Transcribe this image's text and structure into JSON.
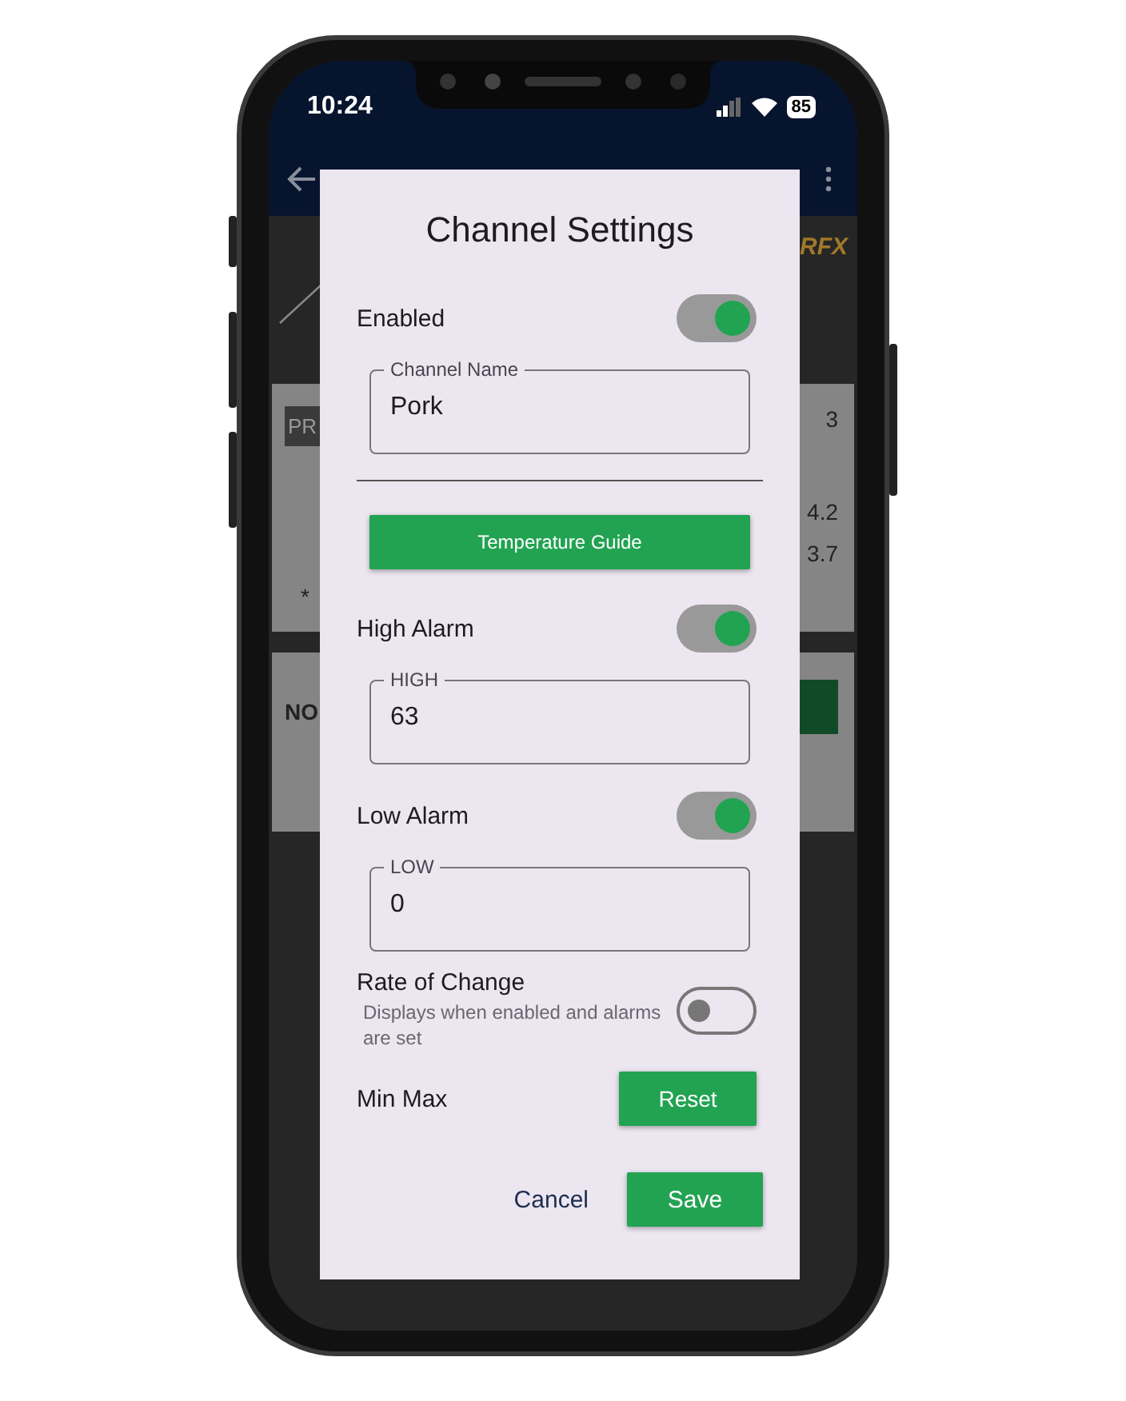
{
  "status_bar": {
    "time": "10:24",
    "battery": "85"
  },
  "background": {
    "logo": "RFX",
    "card_1": {
      "tag": "PR",
      "note": "*",
      "values": [
        "3",
        "4.2",
        "3.7"
      ]
    },
    "card_2": {
      "label": "NO"
    }
  },
  "dialog": {
    "title": "Channel Settings",
    "enabled": {
      "label": "Enabled",
      "on": true
    },
    "channel_name": {
      "label": "Channel Name",
      "value": "Pork"
    },
    "guide_button": "Temperature Guide",
    "high_alarm": {
      "label": "High Alarm",
      "on": true,
      "field_label": "HIGH",
      "value": "63"
    },
    "low_alarm": {
      "label": "Low Alarm",
      "on": true,
      "field_label": "LOW",
      "value": "0"
    },
    "rate_of_change": {
      "label": "Rate of Change",
      "description": "Displays when enabled and alarms are set",
      "on": false
    },
    "min_max": {
      "label": "Min Max",
      "button": "Reset"
    },
    "actions": [
      {
        "label": "Cancel",
        "kind": "text"
      },
      {
        "label": "Save",
        "kind": "filled"
      }
    ]
  }
}
